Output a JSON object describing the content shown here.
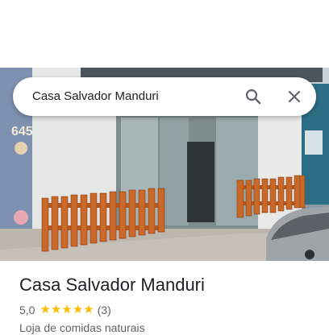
{
  "search": {
    "query": "Casa Salvador Manduri",
    "search_icon": "search-icon",
    "close_icon": "close-icon"
  },
  "photo": {
    "street_number": "645"
  },
  "place": {
    "name": "Casa Salvador Manduri",
    "rating": "5,0",
    "stars": 5,
    "review_count": "(3)",
    "category": "Loja de comidas naturais"
  },
  "colors": {
    "star": "#fbbc04",
    "fence": "#b75a22",
    "text_primary": "#202124",
    "text_secondary": "#5f6368"
  }
}
